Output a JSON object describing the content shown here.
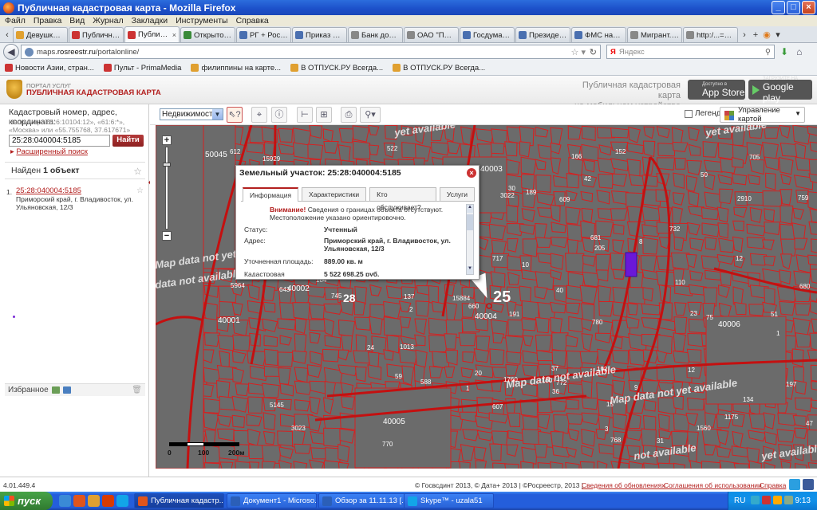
{
  "browser": {
    "window_title": "Публичная кадастровая карта - Mozilla Firefox",
    "menu": [
      "Файл",
      "Правка",
      "Вид",
      "Журнал",
      "Закладки",
      "Инструменты",
      "Справка"
    ],
    "tabs": [
      {
        "label": "Девушка-го...",
        "color": "#e0a030"
      },
      {
        "label": "Публичная к...",
        "color": "#c33"
      },
      {
        "label": "Публичн...",
        "color": "#c33",
        "active": true
      },
      {
        "label": "Открытое п...",
        "color": "#3a8a3a"
      },
      {
        "label": "РГ + Россия ...",
        "color": "#4a6fb0"
      },
      {
        "label": "Приказ Мин...",
        "color": "#4a6fb0"
      },
      {
        "label": "Банк докуме...",
        "color": "#888"
      },
      {
        "label": "ОАО \"Примо...",
        "color": "#888"
      },
      {
        "label": "Госдума под...",
        "color": "#4a6fb0"
      },
      {
        "label": "Президент н...",
        "color": "#4a6fb0"
      },
      {
        "label": "ФМС насчит...",
        "color": "#4a6fb0"
      },
      {
        "label": "Мигрант. Фе...",
        "color": "#888"
      },
      {
        "label": "http:/...=48s=",
        "color": "#888"
      }
    ],
    "url_prefix": "maps.",
    "url_host": "rosreestr.ru",
    "url_path": "/portalonline/",
    "search_placeholder": "Яндекс",
    "search_engine_glyph": "Я",
    "bookmarks": [
      {
        "label": "Новости Азии, стран...",
        "color": "#c33"
      },
      {
        "label": "Пульт - PrimaMedia",
        "color": "#c33"
      },
      {
        "label": "филиппины на карте...",
        "color": "#e0a030"
      },
      {
        "label": "В ОТПУСК.РУ Всегда...",
        "color": "#e0a030"
      },
      {
        "label": "В ОТПУСК.РУ Всегда...",
        "color": "#e0a030"
      }
    ]
  },
  "header": {
    "portal_small": "ПОРТАЛ УСЛУГ",
    "portal_title": "ПУБЛИЧНАЯ КАДАСТРОВАЯ КАРТА",
    "mobile_line1": "Публичная кадастровая карта",
    "mobile_line2": "на мобильном устройстве",
    "appstore_small": "Доступно в",
    "appstore": "App Store",
    "gplay_small": "ЗАГРУЗИТЕ НА",
    "gplay": "Google play"
  },
  "left_panel": {
    "search_label": "Кадастровый номер, адрес, координата:",
    "search_hint": "Например «61:6:10104:12», «61:6:*», «Москва» или «55.755768, 37.617671»",
    "search_value": "25:28:040004:5185",
    "find_button": "Найти",
    "extended_search": "Расширенный поиск",
    "found_prefix": "Найден",
    "found_count": "1 объект",
    "result_num": "1.",
    "result_link": "25:28:040004:5185",
    "result_address": "Приморский край, г. Владивосток, ул. Ульяновская, 12/3",
    "favorites_label": "Избранное"
  },
  "toolbar": {
    "layer_select": "Недвижимость",
    "legend_label": "Легенда",
    "map_management": "Управление картой"
  },
  "popup": {
    "title": "Земельный участок: 25:28:040004:5185",
    "tabs": [
      "Информация",
      "Характеристики",
      "Кто обслуживает?",
      "Услуги"
    ],
    "warning_bold": "Внимание!",
    "warning_text": "Сведения о границах объекта отсутствуют. Местоположение указано ориентировочно.",
    "rows": [
      {
        "key": "Статус:",
        "value": "Учтенный"
      },
      {
        "key": "Адрес:",
        "value": "Приморский край, г. Владивосток, ул. Ульяновская, 12/3"
      },
      {
        "key": "Уточненная площадь:",
        "value": "889.00 кв. м"
      },
      {
        "key": "Кадастровая стоимость:",
        "value": "5 522 698.25 руб."
      }
    ]
  },
  "map": {
    "quarter_labels": [
      {
        "text": "50045"
      },
      {
        "text": "40002"
      },
      {
        "text": "40001"
      },
      {
        "text": "28"
      },
      {
        "text": "40004"
      },
      {
        "text": "25"
      },
      {
        "text": "40006"
      },
      {
        "text": "40005"
      },
      {
        "text": "40003"
      }
    ],
    "parcel_labels": [
      "134",
      "197",
      "37",
      "166",
      "9",
      "8",
      "31",
      "47",
      "6",
      "15",
      "184",
      "137",
      "152",
      "150",
      "20",
      "3023",
      "3022",
      "2910",
      "588",
      "522",
      "759",
      "768",
      "1013",
      "15929",
      "1",
      "12",
      "30",
      "1",
      "2",
      "36",
      "772",
      "680",
      "681",
      "780",
      "745",
      "612",
      "717",
      "770",
      "779",
      "15884",
      "609",
      "643",
      "732",
      "660",
      "607",
      "705",
      "698",
      "1760",
      "696",
      "5145",
      "191",
      "1560",
      "40",
      "75",
      "24",
      "51",
      "50",
      "12",
      "10",
      "23",
      "110",
      "205",
      "151",
      "189",
      "192",
      "176",
      "1150",
      "1175",
      "5964",
      "3",
      "42",
      "59"
    ],
    "watermarks": [
      "yet available",
      "yet available",
      "Map data not available",
      "Map data not yet available",
      "Map data not yet available",
      "data not available",
      "not available",
      "yet available"
    ],
    "scale_labels": [
      "0",
      "100",
      "200м"
    ]
  },
  "footer": {
    "version": "4.01.449.4",
    "copyright": "© Госвсдинт 2013, © Дата+ 2013 | ©Росреестр, 2013 |",
    "updates": "Сведения об обновлениях",
    "terms": "Соглашения об использовании",
    "help": "Справка"
  },
  "taskbar": {
    "start": "пуск",
    "tasks": [
      {
        "label": "Публичная кадастр...",
        "color": "#e0551c",
        "active": true
      },
      {
        "label": "Документ1 - Microso...",
        "color": "#2b5fb8"
      },
      {
        "label": "Обзор за 11.11.13 [...",
        "color": "#2b5fb8"
      },
      {
        "label": "Skype™ - uzala51",
        "color": "#12a5e8"
      }
    ],
    "lang": "RU",
    "clock": "9:13"
  }
}
